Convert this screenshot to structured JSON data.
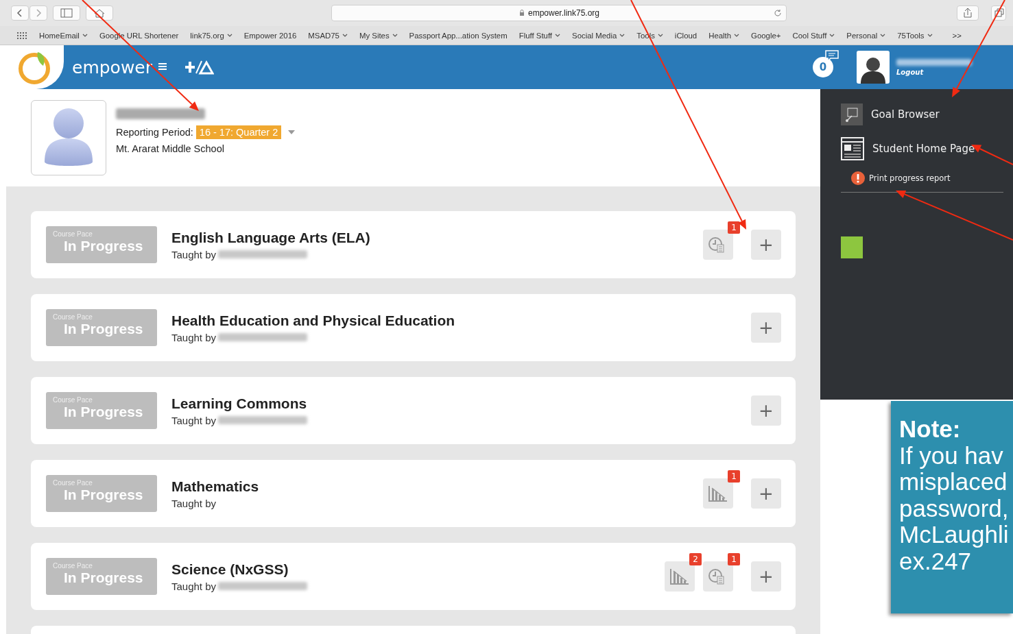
{
  "browser": {
    "address": "empower.link75.org",
    "bookmarks": [
      {
        "label": "HomeEmail",
        "menu": true
      },
      {
        "label": "Google URL Shortener",
        "menu": false
      },
      {
        "label": "link75.org",
        "menu": true
      },
      {
        "label": "Empower 2016",
        "menu": false
      },
      {
        "label": "MSAD75",
        "menu": true
      },
      {
        "label": "My Sites",
        "menu": true
      },
      {
        "label": "Passport App...ation System",
        "menu": false
      },
      {
        "label": "Fluff Stuff",
        "menu": true
      },
      {
        "label": "Social Media",
        "menu": true
      },
      {
        "label": "Tools",
        "menu": true
      },
      {
        "label": "iCloud",
        "menu": false
      },
      {
        "label": "Health",
        "menu": true
      },
      {
        "label": "Google+",
        "menu": false
      },
      {
        "label": "Cool Stuff",
        "menu": true
      },
      {
        "label": "Personal",
        "menu": true
      },
      {
        "label": "75Tools",
        "menu": true
      }
    ],
    "more": ">>"
  },
  "header": {
    "brand": "empower",
    "notifications": "0",
    "logout": "Logout"
  },
  "student": {
    "period_label": "Reporting Period:",
    "period": "16 - 17: Quarter 2",
    "school": "Mt. Ararat Middle School"
  },
  "courses": [
    {
      "pace_label": "Course Pace",
      "status": "In Progress",
      "title": "English Language Arts (ELA)",
      "taught_by": "Taught by",
      "teacher_hidden": true,
      "actions": [
        {
          "kind": "history",
          "badge": "1"
        }
      ]
    },
    {
      "pace_label": "Course Pace",
      "status": "In Progress",
      "title": "Health Education and Physical Education",
      "taught_by": "Taught by",
      "teacher_hidden": true
    },
    {
      "pace_label": "Course Pace",
      "status": "In Progress",
      "title": "Learning Commons",
      "taught_by": "Taught by",
      "teacher_hidden": true
    },
    {
      "pace_label": "Course Pace",
      "status": "In Progress",
      "title": "Mathematics",
      "taught_by": "Taught by",
      "teacher_hidden": false,
      "actions": [
        {
          "kind": "chart",
          "badge": "1"
        }
      ]
    },
    {
      "pace_label": "Course Pace",
      "status": "In Progress",
      "title": "Science (NxGSS)",
      "taught_by": "Taught by",
      "teacher_hidden": true,
      "actions": [
        {
          "kind": "chart",
          "badge": "2"
        },
        {
          "kind": "history",
          "badge": "1"
        }
      ]
    }
  ],
  "add_button": "+",
  "menu": {
    "items": [
      {
        "kind": "goal",
        "label": "Goal Browser"
      },
      {
        "kind": "home",
        "label": "Student Home Page"
      },
      {
        "kind": "alert",
        "label": "Print progress report"
      }
    ]
  },
  "note": {
    "title": "Note:",
    "lines": [
      "If you hav",
      "misplaced",
      "password,",
      "McLaughli",
      "ex.247"
    ]
  }
}
